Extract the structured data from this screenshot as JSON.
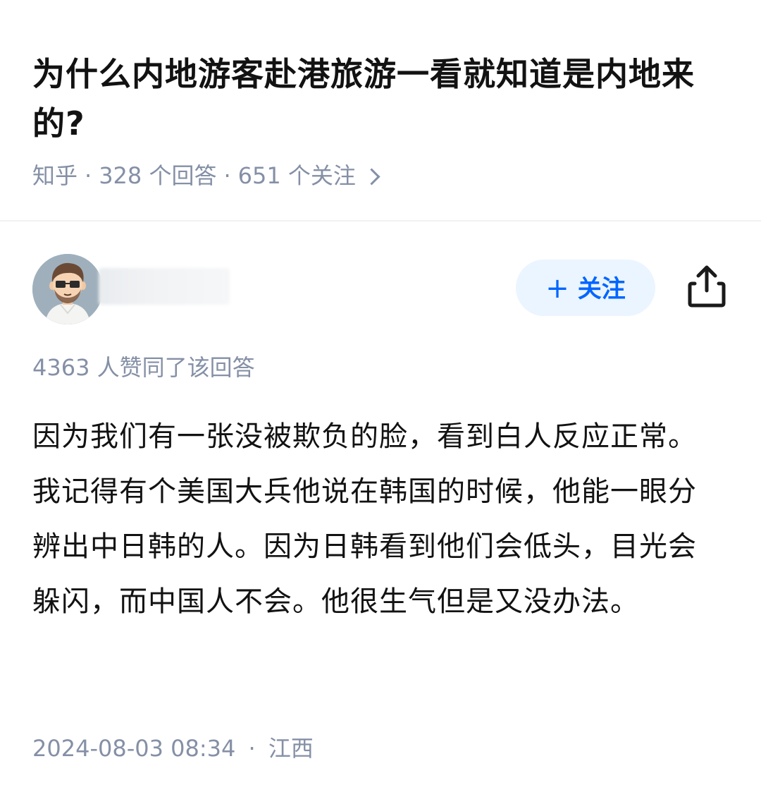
{
  "question": {
    "title": "为什么内地游客赴港旅游一看就知道是内地来的?",
    "source": "知乎",
    "answers_count": "328 个回答",
    "followers_count": "651 个关注",
    "separator": "·"
  },
  "author": {
    "follow_button_label": "+ 关注",
    "follow_plus": "+",
    "follow_text": "关注",
    "avatar_icon": "avatar-cartoon-glasses",
    "share_icon": "share-icon",
    "colors": {
      "follow_bg": "#ebf5ff",
      "follow_text": "#0066ff"
    }
  },
  "answer": {
    "vote_text": "4363 人赞同了该回答",
    "content": "因为我们有一张没被欺负的脸，看到白人反应正常。我记得有个美国大兵他说在韩国的时候，他能一眼分辨出中日韩的人。因为日韩看到他们会低头，目光会躲闪，而中国人不会。他很生气但是又没办法。",
    "timestamp": "2024-08-03 08:34",
    "location": "江西",
    "separator": "·"
  },
  "theme": {
    "text_primary": "#121212",
    "text_secondary": "#8590a6",
    "divider": "#f0f1f3"
  }
}
